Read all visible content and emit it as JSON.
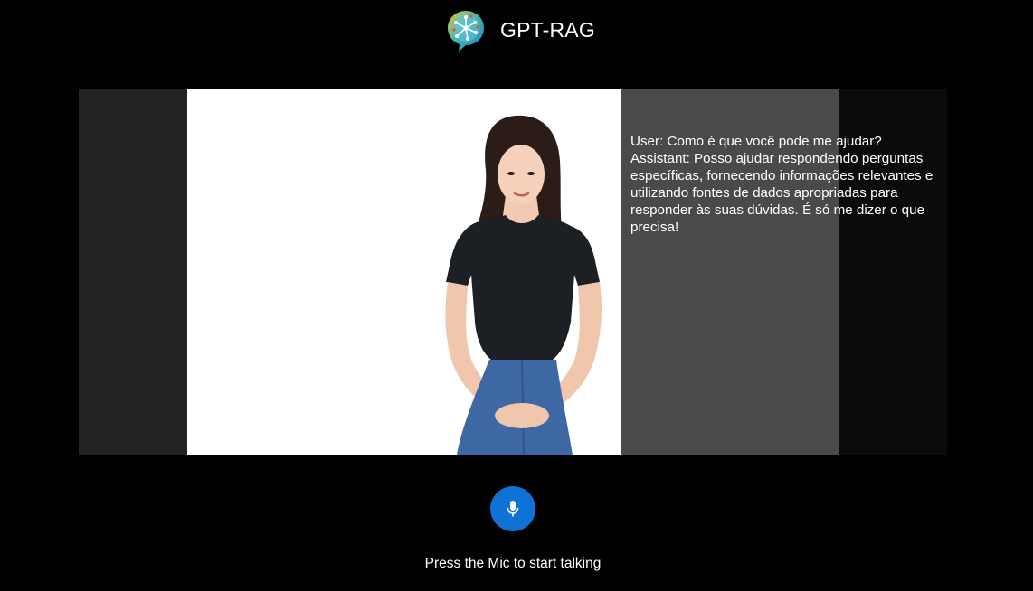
{
  "header": {
    "title": "GPT-RAG",
    "logo_icon": "chat-bubble-network-logo-icon"
  },
  "transcript": {
    "user_line": "User: Como é que você pode me ajudar?",
    "assistant_line": "Assistant: Posso ajudar respondendo perguntas específicas, fornecendo informações relevantes e utilizando fontes de dados apropriadas para responder às suas dúvidas. É só me dizer o que precisa!"
  },
  "controls": {
    "mic_icon": "microphone-icon",
    "hint": "Press the Mic to start talking"
  },
  "colors": {
    "background": "#000000",
    "stage_background": "#232323",
    "transcript_background": "#4a4a4a",
    "mic_button": "#0f73d6",
    "text": "#ffffff"
  }
}
